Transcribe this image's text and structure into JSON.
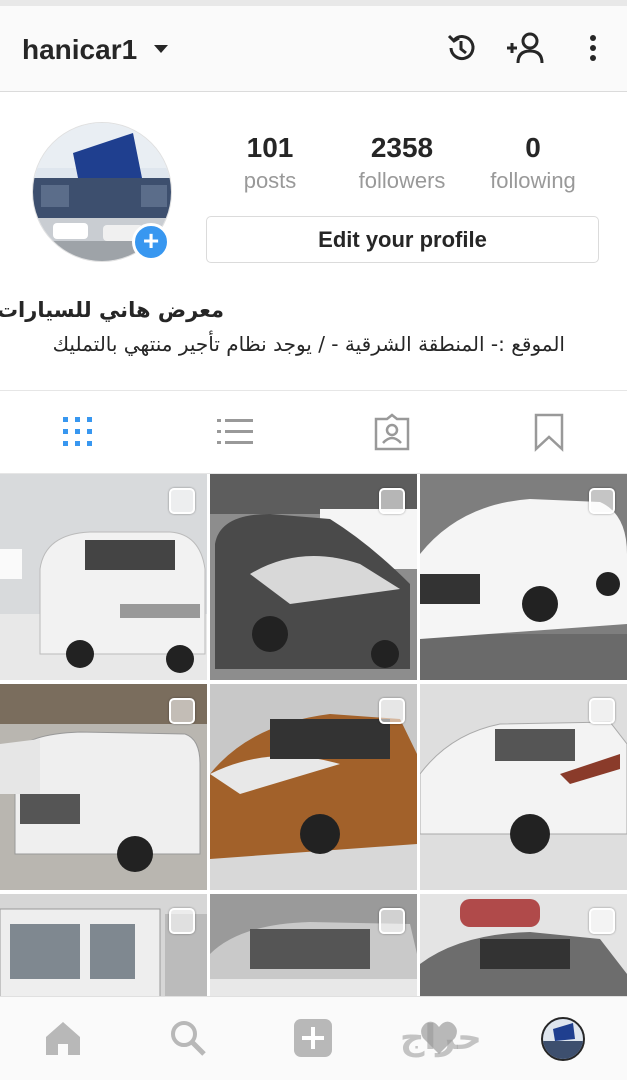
{
  "header": {
    "username": "hanicar1",
    "icons": [
      "history-icon",
      "add-person-icon",
      "more-vertical-icon"
    ]
  },
  "profile": {
    "stats": [
      {
        "value": "101",
        "label": "posts"
      },
      {
        "value": "2358",
        "label": "followers"
      },
      {
        "value": "0",
        "label": "following"
      }
    ],
    "edit_button": "Edit your profile",
    "add_badge": "+",
    "bio_name": "معرض هاني للسيارات",
    "bio_text": "الموقع :- المنطقة الشرقية - / يوجد نظام تأجير منتهي بالتمليك"
  },
  "tabs": [
    "grid-icon",
    "list-icon",
    "tagged-icon",
    "saved-icon"
  ],
  "grid": {
    "posts": [
      {
        "subject": "white minivan",
        "color": "#f2f2f2"
      },
      {
        "subject": "dark grey sedan",
        "color": "#4a4a4a"
      },
      {
        "subject": "white sedan",
        "color": "#f5f5f5"
      },
      {
        "subject": "white suv",
        "color": "#efefef"
      },
      {
        "subject": "orange crossover",
        "color": "#a2612a"
      },
      {
        "subject": "white pickup",
        "color": "#f3f3f3"
      },
      {
        "subject": "white truck",
        "color": "#eeeeee"
      },
      {
        "subject": "silver van",
        "color": "#c9c9c9"
      },
      {
        "subject": "grey hatchback",
        "color": "#6d6d6d"
      }
    ]
  },
  "bottom_nav": [
    "home-icon",
    "search-icon",
    "add-post-icon",
    "activity-heart-icon",
    "profile-avatar-icon"
  ],
  "watermark": "حراج"
}
